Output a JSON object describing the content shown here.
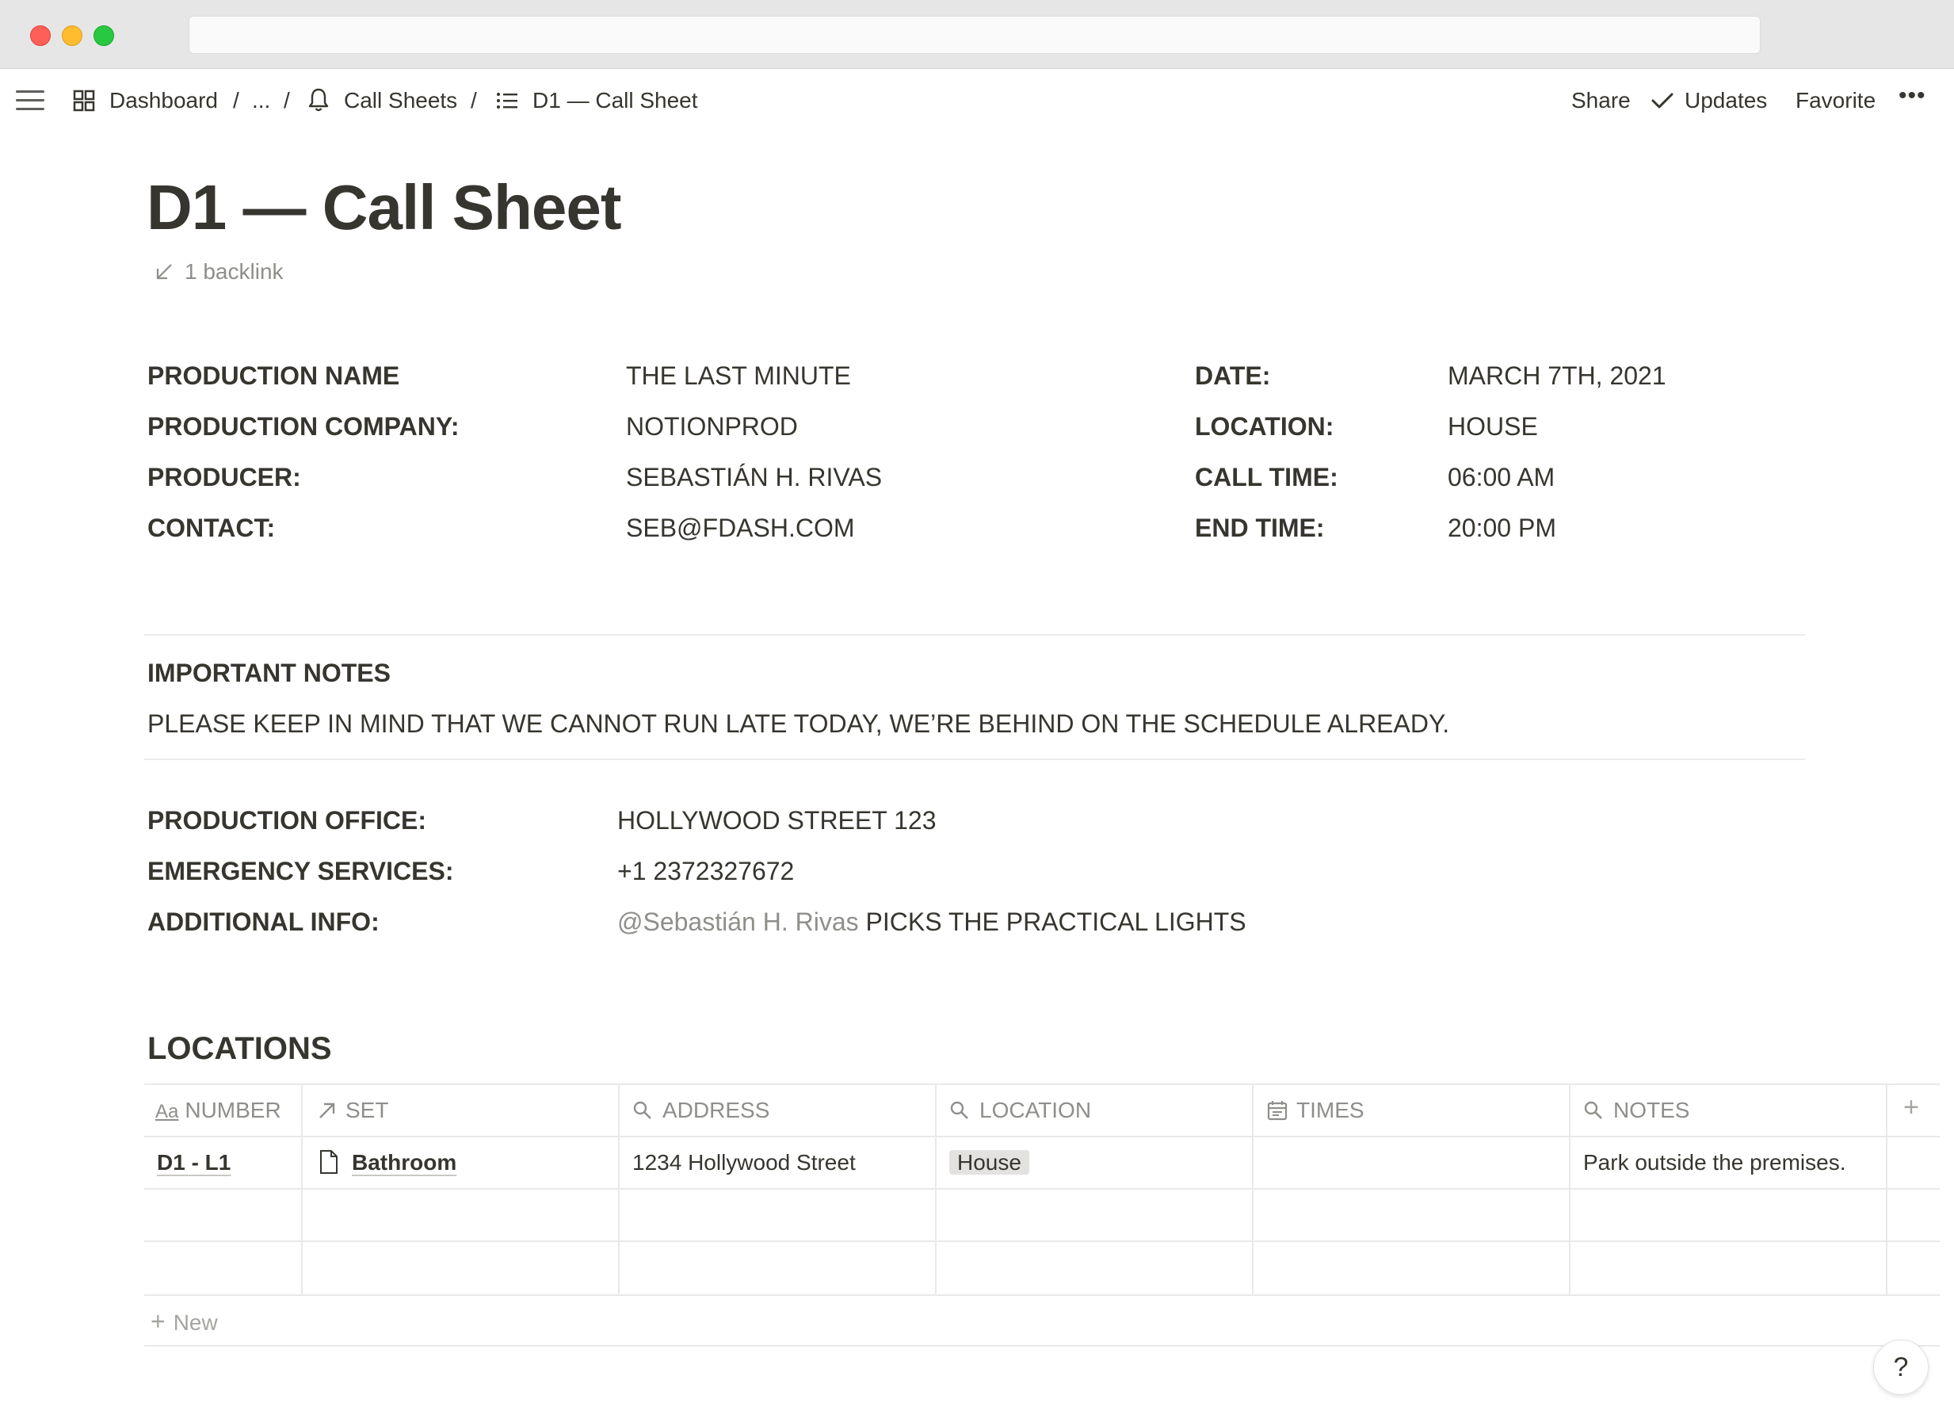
{
  "breadcrumb": {
    "dashboard": "Dashboard",
    "ellipsis": "...",
    "call_sheets": "Call Sheets",
    "current": "D1 — Call Sheet",
    "separator": "/"
  },
  "topbar": {
    "share": "Share",
    "updates": "Updates",
    "favorite": "Favorite",
    "more": "•••"
  },
  "page": {
    "title": "D1 — Call Sheet",
    "backlinks": "1 backlink"
  },
  "info_left": [
    {
      "label": "PRODUCTION NAME",
      "value": "THE LAST MINUTE"
    },
    {
      "label": "PRODUCTION COMPANY:",
      "value": "NOTIONPROD"
    },
    {
      "label": "PRODUCER:",
      "value": "SEBASTIÁN H. RIVAS"
    },
    {
      "label": "CONTACT:",
      "value": "SEB@FDASH.COM"
    }
  ],
  "info_right": [
    {
      "label": "DATE:",
      "value": "MARCH 7TH, 2021"
    },
    {
      "label": "LOCATION:",
      "value": "HOUSE"
    },
    {
      "label": "CALL TIME:",
      "value": "06:00 AM"
    },
    {
      "label": "END TIME:",
      "value": "20:00 PM"
    }
  ],
  "notes": {
    "heading": "IMPORTANT NOTES",
    "text": "PLEASE KEEP IN MIND THAT WE CANNOT RUN LATE TODAY, WE’RE BEHIND ON THE SCHEDULE ALREADY."
  },
  "office": [
    {
      "label": "PRODUCTION OFFICE:",
      "value": "HOLLYWOOD STREET 123"
    },
    {
      "label": "EMERGENCY SERVICES:",
      "value": "+1 2372327672"
    },
    {
      "label": "ADDITIONAL INFO:",
      "mention": "@Sebastián H. Rivas",
      "value": " PICKS THE PRACTICAL LIGHTS"
    }
  ],
  "locations": {
    "heading": "LOCATIONS",
    "columns": [
      "NUMBER",
      "SET",
      "ADDRESS",
      "LOCATION",
      "TIMES",
      "NOTES"
    ],
    "rows": [
      {
        "number": "D1 - L1",
        "set": "Bathroom",
        "address": "1234 Hollywood Street",
        "location": "House",
        "times": "",
        "notes": "Park outside the premises."
      }
    ],
    "new_label": "New"
  },
  "help": "?"
}
